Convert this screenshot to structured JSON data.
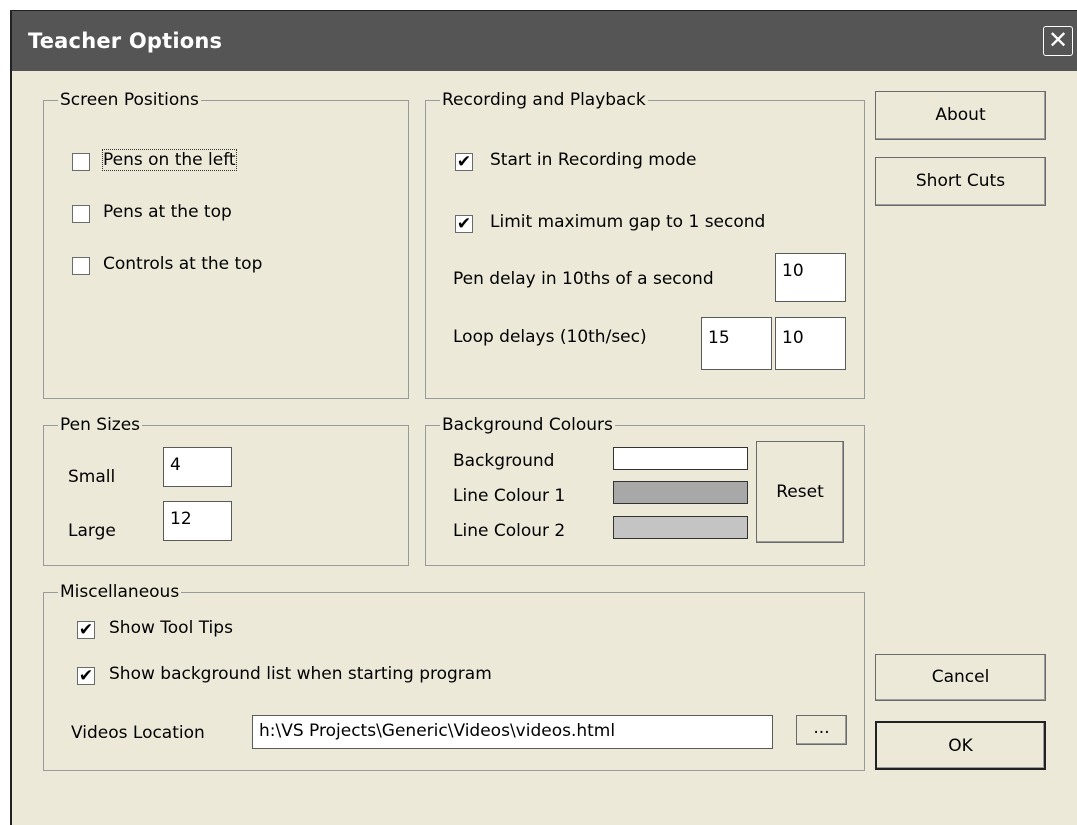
{
  "window": {
    "title": "Teacher Options",
    "close_symbol": "✕"
  },
  "screen_positions": {
    "legend": "Screen Positions",
    "pens_left": {
      "label": "Pens on the left",
      "checked": false
    },
    "pens_top": {
      "label": "Pens at the top",
      "checked": false
    },
    "controls_top": {
      "label": "Controls at the top",
      "checked": false
    }
  },
  "recording": {
    "legend": "Recording and Playback",
    "start_recording": {
      "label": "Start in Recording mode",
      "checked": true
    },
    "limit_gap": {
      "label": "Limit maximum gap to 1 second",
      "checked": true
    },
    "pen_delay_label": "Pen delay in 10ths of a second",
    "pen_delay_value": "10",
    "loop_delays_label": "Loop delays (10th/sec)",
    "loop_delay_1": "15",
    "loop_delay_2": "10"
  },
  "pen_sizes": {
    "legend": "Pen Sizes",
    "small_label": "Small",
    "small_value": "4",
    "large_label": "Large",
    "large_value": "12"
  },
  "background_colours": {
    "legend": "Background Colours",
    "background_label": "Background",
    "line1_label": "Line Colour 1",
    "line2_label": "Line Colour 2",
    "reset_label": "Reset",
    "colors": {
      "background": "#ffffff",
      "line1": "#a8a8a8",
      "line2": "#c4c4c4"
    }
  },
  "misc": {
    "legend": "Miscellaneous",
    "tool_tips": {
      "label": "Show Tool Tips",
      "checked": true
    },
    "bg_list": {
      "label": "Show background list when starting program",
      "checked": true
    },
    "videos_label": "Videos Location",
    "videos_value": "h:\\VS Projects\\Generic\\Videos\\videos.html",
    "browse_label": "..."
  },
  "buttons": {
    "about": "About",
    "short_cuts": "Short Cuts",
    "cancel": "Cancel",
    "ok": "OK"
  },
  "check_mark": "✔"
}
